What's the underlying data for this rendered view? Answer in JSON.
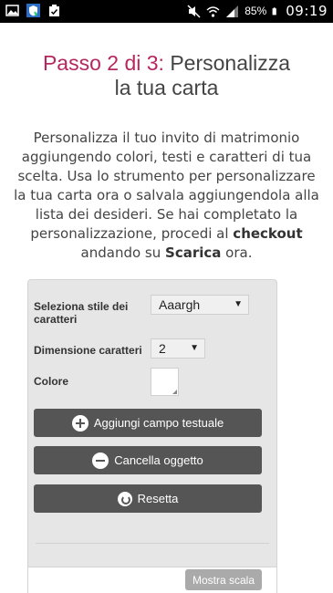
{
  "status_bar": {
    "battery": "85%",
    "time": "09:19",
    "icons": [
      "gallery-icon",
      "shield-app-icon",
      "clipboard-icon",
      "mute-icon",
      "wifi-icon",
      "signal-icon",
      "battery-icon"
    ]
  },
  "heading": {
    "step": "Passo 2 di 3:",
    "title_line1": "Personalizza",
    "title_line2": "la tua carta"
  },
  "intro": {
    "text1": "Personalizza il tuo invito di matrimonio aggiungendo colori, testi e caratteri di tua scelta. Usa lo strumento per personalizzare la tua carta ora o salvala aggiungendola alla lista dei desideri. Se hai completato la personalizzazione, procedi al ",
    "checkout": "checkout",
    "text2": " andando su ",
    "scarica": "Scarica",
    "text3": " ora."
  },
  "editor": {
    "font_style_label": "Seleziona stile dei caratteri",
    "font_style_value": "Aaargh",
    "font_size_label": "Dimensione caratteri",
    "font_size_value": "2",
    "color_label": "Colore",
    "color_value": "#ffffff",
    "add_text_button": "Aggiungi campo testuale",
    "delete_button": "Cancella oggetto",
    "reset_button": "Resetta",
    "show_scale_button": "Mostra scala"
  },
  "colors": {
    "accent": "#b5275f",
    "button": "#555555",
    "button_disabled": "#aaaaaa",
    "panel": "#e6e6e6"
  }
}
